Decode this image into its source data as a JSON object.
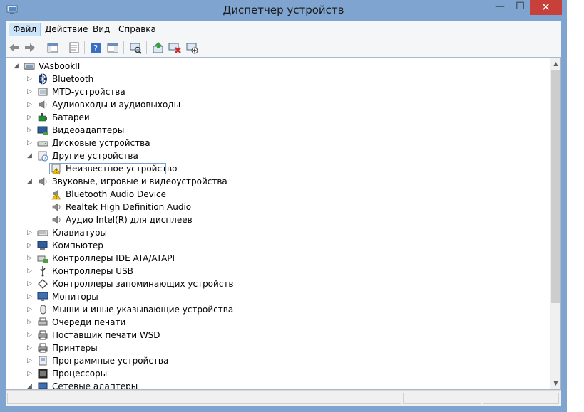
{
  "window": {
    "title": "Диспетчер устройств",
    "minimize_glyph": "—",
    "maximize_glyph": "☐",
    "close_glyph": "✕"
  },
  "menu": {
    "items": [
      "Файл",
      "Действие",
      "Вид",
      "Справка"
    ],
    "active_index": 0
  },
  "toolbar": {
    "buttons": [
      "back-icon",
      "forward-icon",
      "console-tree-icon",
      "properties-sheet-icon",
      "help-icon",
      "action-pane-icon",
      "scan-hardware-icon",
      "update-driver-icon",
      "uninstall-device-icon",
      "add-hardware-icon"
    ]
  },
  "tree": {
    "root": "VAsbookII",
    "items": [
      {
        "label": "Bluetooth",
        "icon": "bluetooth-icon",
        "level": 1,
        "expander": "collapsed"
      },
      {
        "label": "MTD-устройства",
        "icon": "mtd-device-icon",
        "level": 1,
        "expander": "collapsed"
      },
      {
        "label": "Аудиовходы и аудиовыходы",
        "icon": "speaker-icon",
        "level": 1,
        "expander": "collapsed"
      },
      {
        "label": "Батареи",
        "icon": "battery-icon",
        "level": 1,
        "expander": "collapsed"
      },
      {
        "label": "Видеоадаптеры",
        "icon": "display-adapter-icon",
        "level": 1,
        "expander": "collapsed"
      },
      {
        "label": "Дисковые устройства",
        "icon": "disk-drive-icon",
        "level": 1,
        "expander": "collapsed"
      },
      {
        "label": "Другие устройства",
        "icon": "unknown-category-icon",
        "level": 1,
        "expander": "expanded"
      },
      {
        "label": "Неизвестное устройство",
        "icon": "warning-device-icon",
        "level": 2,
        "expander": "none",
        "selected": true
      },
      {
        "label": "Звуковые, игровые и видеоустройства",
        "icon": "speaker-icon",
        "level": 1,
        "expander": "expanded"
      },
      {
        "label": "Bluetooth Audio Device",
        "icon": "warning-speaker-icon",
        "level": 2,
        "expander": "none"
      },
      {
        "label": "Realtek High Definition Audio",
        "icon": "speaker-icon",
        "level": 2,
        "expander": "none"
      },
      {
        "label": "Аудио Intel(R) для дисплеев",
        "icon": "speaker-icon",
        "level": 2,
        "expander": "none"
      },
      {
        "label": "Клавиатуры",
        "icon": "keyboard-icon",
        "level": 1,
        "expander": "collapsed"
      },
      {
        "label": "Компьютер",
        "icon": "computer-icon",
        "level": 1,
        "expander": "collapsed"
      },
      {
        "label": "Контроллеры IDE ATA/ATAPI",
        "icon": "ide-controller-icon",
        "level": 1,
        "expander": "collapsed"
      },
      {
        "label": "Контроллеры USB",
        "icon": "usb-icon",
        "level": 1,
        "expander": "collapsed"
      },
      {
        "label": "Контроллеры запоминающих устройств",
        "icon": "storage-controller-icon",
        "level": 1,
        "expander": "collapsed"
      },
      {
        "label": "Мониторы",
        "icon": "monitor-icon",
        "level": 1,
        "expander": "collapsed"
      },
      {
        "label": "Мыши и иные указывающие устройства",
        "icon": "mouse-icon",
        "level": 1,
        "expander": "collapsed"
      },
      {
        "label": "Очереди печати",
        "icon": "print-queue-icon",
        "level": 1,
        "expander": "collapsed"
      },
      {
        "label": "Поставщик печати WSD",
        "icon": "printer-icon",
        "level": 1,
        "expander": "collapsed"
      },
      {
        "label": "Принтеры",
        "icon": "printer-icon",
        "level": 1,
        "expander": "collapsed"
      },
      {
        "label": "Программные устройства",
        "icon": "software-device-icon",
        "level": 1,
        "expander": "collapsed"
      },
      {
        "label": "Процессоры",
        "icon": "processor-icon",
        "level": 1,
        "expander": "collapsed"
      },
      {
        "label": "Сетевые адаптеры",
        "icon": "network-adapter-icon",
        "level": 1,
        "expander": "expanded"
      }
    ]
  },
  "scroll": {
    "up_glyph": "▲",
    "down_glyph": "▼",
    "position": 0.0
  },
  "colors": {
    "frame": "#7fa4d0",
    "close": "#c7403a",
    "selection_border": "#7da2ce",
    "warning": "#f2c200"
  }
}
